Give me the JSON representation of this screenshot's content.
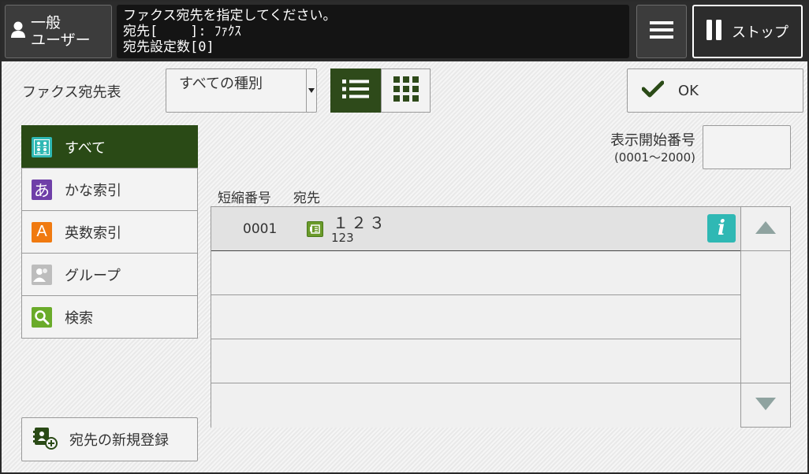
{
  "topbar": {
    "user_label": "一般\nユーザー",
    "message_line1": "ファクス宛先を指定してください。",
    "message_line2": "宛先[    ]: ﾌｧｸｽ",
    "message_line3": "宛先設定数[0]",
    "stop_label": "ストップ"
  },
  "header": {
    "addrbook_label": "ファクス宛先表",
    "type_select_value": "すべての種別",
    "ok_label": "OK"
  },
  "categories": [
    {
      "label": "すべて",
      "icon": "grid-people-icon",
      "icon_glyph": "",
      "color": "#2fb8b4",
      "active": true
    },
    {
      "label": "かな索引",
      "icon": "kana-icon",
      "icon_glyph": "あ",
      "color": "#6f3fa8",
      "active": false
    },
    {
      "label": "英数索引",
      "icon": "alpha-icon",
      "icon_glyph": "A",
      "color": "#f07a10",
      "active": false
    },
    {
      "label": "グループ",
      "icon": "group-icon",
      "icon_glyph": "",
      "color": "#bdbdbd",
      "active": false
    },
    {
      "label": "検索",
      "icon": "search-icon",
      "icon_glyph": "",
      "color": "#6aab2a",
      "active": false
    }
  ],
  "new_entry_label": "宛先の新規登録",
  "start_number": {
    "label": "表示開始番号",
    "range": "(0001〜2000)",
    "value": ""
  },
  "table": {
    "col_shortnum": "短縮番号",
    "col_dest": "宛先",
    "rows": [
      {
        "num": "0001",
        "name": "１２３",
        "sub": "123"
      },
      {
        "num": "",
        "name": "",
        "sub": ""
      },
      {
        "num": "",
        "name": "",
        "sub": ""
      },
      {
        "num": "",
        "name": "",
        "sub": ""
      },
      {
        "num": "",
        "name": "",
        "sub": ""
      }
    ]
  },
  "colors": {
    "active_green": "#2a4a16",
    "info_teal": "#2fb8b4",
    "fax_green": "#6a9a2a"
  }
}
